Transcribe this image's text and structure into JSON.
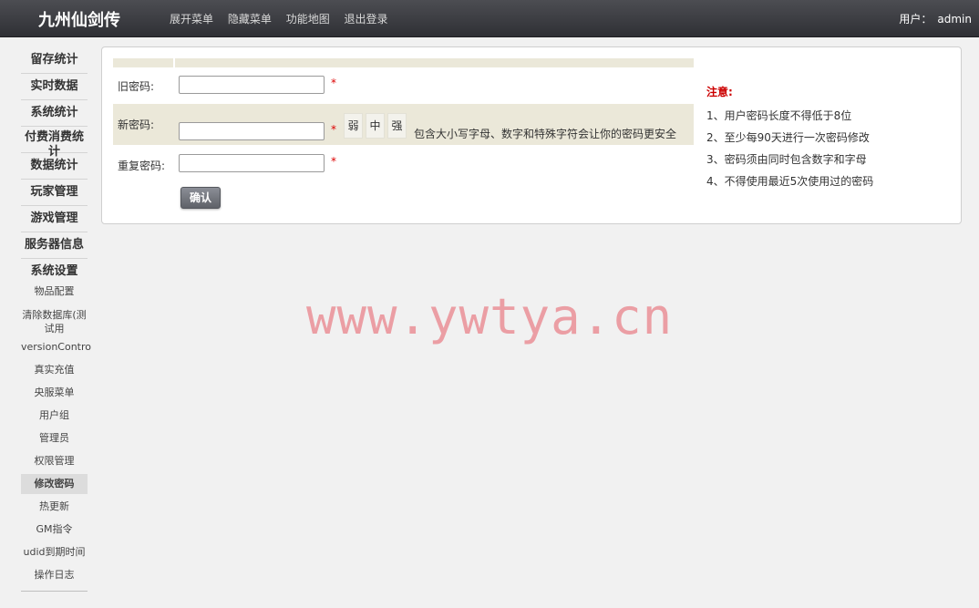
{
  "header": {
    "brand": "九州仙剑传",
    "nav": [
      "展开菜单",
      "隐藏菜单",
      "功能地图",
      "退出登录"
    ],
    "user_label": "用户：",
    "user_name": "admin"
  },
  "sidebar": {
    "categories": [
      "留存统计",
      "实时数据",
      "系统统计",
      "付费消费统计",
      "数据统计",
      "玩家管理",
      "游戏管理",
      "服务器信息",
      "系统设置"
    ],
    "subitems": [
      "物品配置",
      "清除数据库(测试用",
      "versionContro",
      "真实充值",
      "央服菜单",
      "用户组",
      "管理员",
      "权限管理",
      "修改密码",
      "热更新",
      "GM指令",
      "udid到期时间",
      "操作日志"
    ],
    "active": "修改密码"
  },
  "form": {
    "old_label": "旧密码:",
    "new_label": "新密码:",
    "repeat_label": "重复密码:",
    "required_mark": "*",
    "strength": [
      "弱",
      "中",
      "强"
    ],
    "hint": "包含大小写字母、数字和特殊字符会让你的密码更安全",
    "confirm": "确认"
  },
  "notes": {
    "title": "注意:",
    "items": [
      "1、用户密码长度不得低于8位",
      "2、至少每90天进行一次密码修改",
      "3、密码须由同时包含数字和字母",
      "4、不得使用最近5次使用过的密码"
    ]
  },
  "watermark": "www.ywtya.cn"
}
